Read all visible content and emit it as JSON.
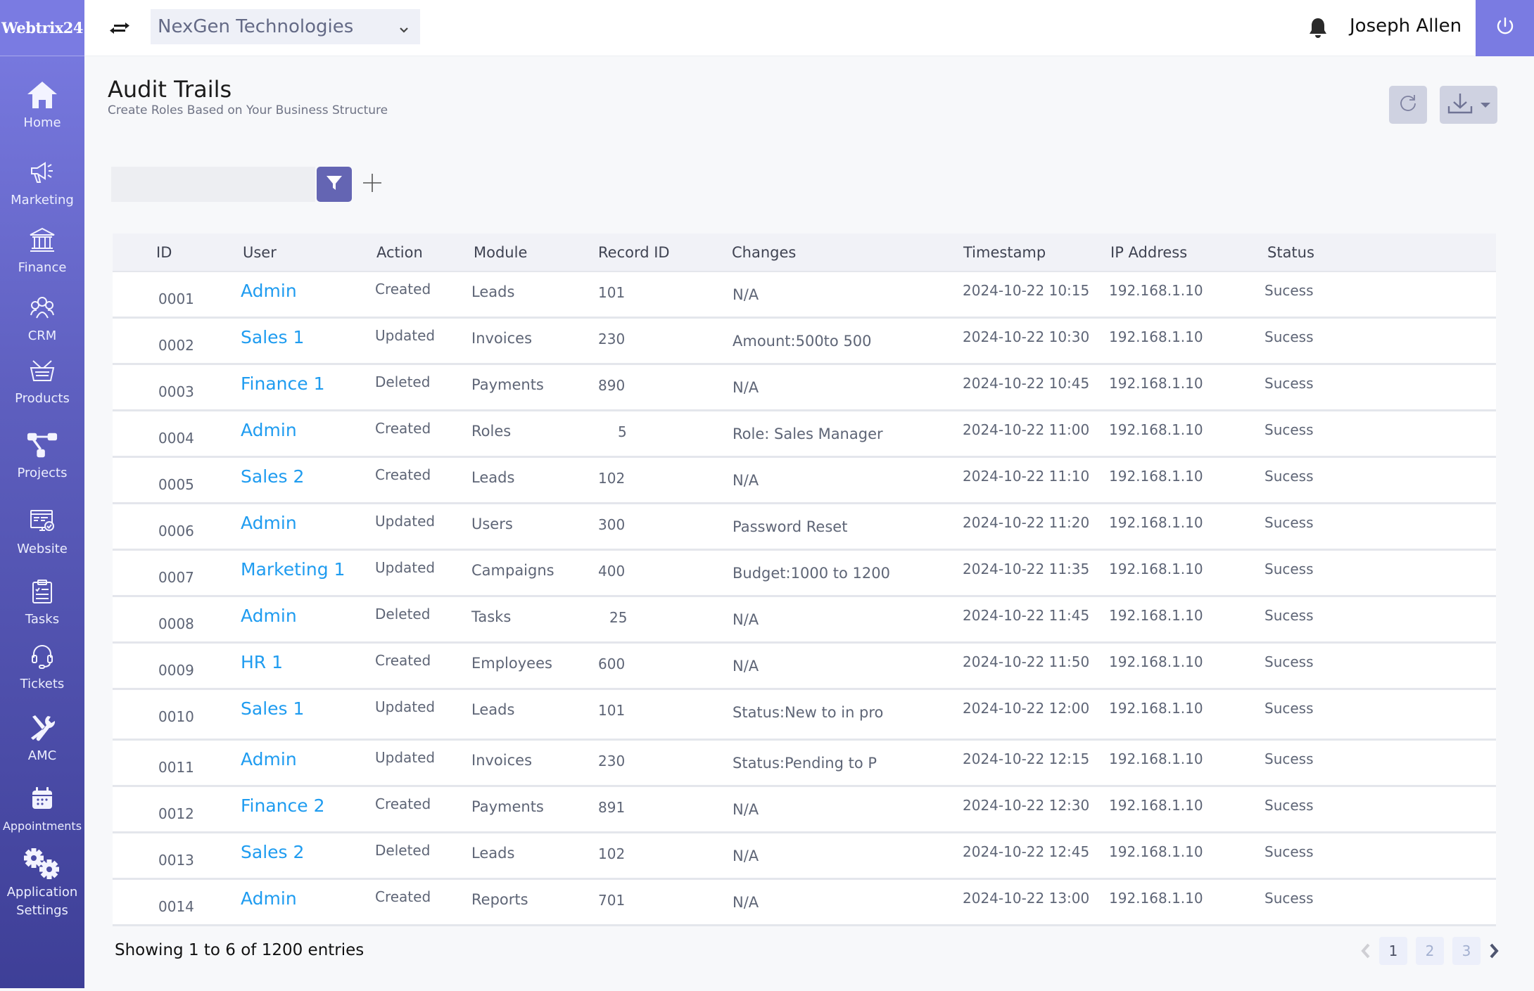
{
  "brand": {
    "logo_text": "Webtrix24",
    "accent": "#7a7be2",
    "link_color": "#1f9cf0"
  },
  "sidebar": {
    "items": [
      {
        "label": "Home",
        "icon": "home-icon"
      },
      {
        "label": "Marketing",
        "icon": "megaphone-icon"
      },
      {
        "label": "Finance",
        "icon": "bank-icon"
      },
      {
        "label": "CRM",
        "icon": "people-icon"
      },
      {
        "label": "Products",
        "icon": "basket-icon"
      },
      {
        "label": "Projects",
        "icon": "project-flow-icon"
      },
      {
        "label": "Website",
        "icon": "website-icon"
      },
      {
        "label": "Tasks",
        "icon": "clipboard-icon"
      },
      {
        "label": "Tickets",
        "icon": "headset-icon"
      },
      {
        "label": "AMC",
        "icon": "tools-icon"
      },
      {
        "label": "Appointments",
        "icon": "calendar-icon"
      },
      {
        "label": "Application Settings",
        "icon": "gears-icon"
      }
    ]
  },
  "header": {
    "company": "NexGen Technologies",
    "user_name": "Joseph Allen"
  },
  "page": {
    "title": "Audit Trails",
    "subtitle": "Create Roles Based on Your Business Structure"
  },
  "filter": {
    "value": "",
    "placeholder": ""
  },
  "table": {
    "columns": [
      "ID",
      "User",
      "Action",
      "Module",
      "Record ID",
      "Changes",
      "Timestamp",
      "IP Address",
      "Status"
    ],
    "rows": [
      {
        "id": "0001",
        "user": "Admin",
        "action": "Created",
        "module": "Leads",
        "record_id": "101",
        "changes": "N/A",
        "timestamp": "2024-10-22 10:15",
        "ip": "192.168.1.10",
        "status": "Sucess"
      },
      {
        "id": "0002",
        "user": "Sales 1",
        "action": "Updated",
        "module": "Invoices",
        "record_id": "230",
        "changes": "Amount:500to 500",
        "timestamp": "2024-10-22 10:30",
        "ip": "192.168.1.10",
        "status": "Sucess"
      },
      {
        "id": "0003",
        "user": "Finance 1",
        "action": "Deleted",
        "module": "Payments",
        "record_id": "890",
        "changes": "N/A",
        "timestamp": "2024-10-22 10:45",
        "ip": "192.168.1.10",
        "status": "Sucess"
      },
      {
        "id": "0004",
        "user": "Admin",
        "action": "Created",
        "module": "Roles",
        "record_id": "5",
        "changes": "Role: Sales Manager",
        "timestamp": "2024-10-22 11:00",
        "ip": "192.168.1.10",
        "status": "Sucess"
      },
      {
        "id": "0005",
        "user": "Sales 2",
        "action": "Created",
        "module": "Leads",
        "record_id": "102",
        "changes": "N/A",
        "timestamp": "2024-10-22 11:10",
        "ip": "192.168.1.10",
        "status": "Sucess"
      },
      {
        "id": "0006",
        "user": "Admin",
        "action": "Updated",
        "module": "Users",
        "record_id": "300",
        "changes": "Password Reset",
        "timestamp": "2024-10-22 11:20",
        "ip": "192.168.1.10",
        "status": "Sucess"
      },
      {
        "id": "0007",
        "user": "Marketing 1",
        "action": "Updated",
        "module": "Campaigns",
        "record_id": "400",
        "changes": "Budget:1000 to 1200",
        "timestamp": "2024-10-22 11:35",
        "ip": "192.168.1.10",
        "status": "Sucess"
      },
      {
        "id": "0008",
        "user": "Admin",
        "action": "Deleted",
        "module": "Tasks",
        "record_id": "25",
        "changes": "N/A",
        "timestamp": "2024-10-22 11:45",
        "ip": "192.168.1.10",
        "status": "Sucess"
      },
      {
        "id": "0009",
        "user": "HR 1",
        "action": "Created",
        "module": "Employees",
        "record_id": "600",
        "changes": "N/A",
        "timestamp": "2024-10-22 11:50",
        "ip": "192.168.1.10",
        "status": "Sucess"
      },
      {
        "id": "0010",
        "user": "Sales 1",
        "action": "Updated",
        "module": "Leads",
        "record_id": "101",
        "changes": "Status:New to in pro",
        "timestamp": "2024-10-22 12:00",
        "ip": "192.168.1.10",
        "status": "Sucess"
      },
      {
        "id": "0011",
        "user": "Admin",
        "action": "Updated",
        "module": "Invoices",
        "record_id": "230",
        "changes": "Status:Pending to P",
        "timestamp": "2024-10-22 12:15",
        "ip": "192.168.1.10",
        "status": "Sucess"
      },
      {
        "id": "0012",
        "user": "Finance 2",
        "action": "Created",
        "module": "Payments",
        "record_id": "891",
        "changes": "N/A",
        "timestamp": "2024-10-22 12:30",
        "ip": "192.168.1.10",
        "status": "Sucess"
      },
      {
        "id": "0013",
        "user": "Sales 2",
        "action": "Deleted",
        "module": "Leads",
        "record_id": "102",
        "changes": "N/A",
        "timestamp": "2024-10-22 12:45",
        "ip": "192.168.1.10",
        "status": "Sucess"
      },
      {
        "id": "0014",
        "user": "Admin",
        "action": "Created",
        "module": "Reports",
        "record_id": "701",
        "changes": "N/A",
        "timestamp": "2024-10-22 13:00",
        "ip": "192.168.1.10",
        "status": "Sucess"
      }
    ]
  },
  "footer": {
    "entries_text": "Showing 1 to 6 of 1200 entries",
    "pages": [
      "1",
      "2",
      "3"
    ],
    "current_page": "1"
  }
}
